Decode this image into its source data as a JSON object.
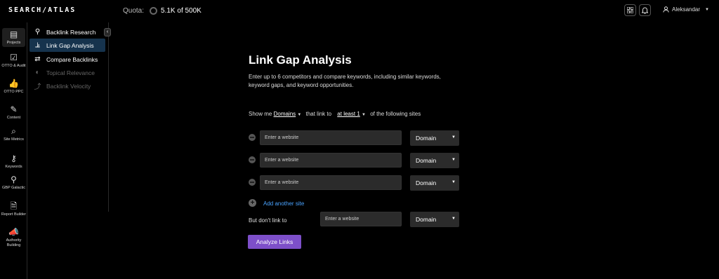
{
  "header": {
    "logo_text": "SEARCH/ATLAS",
    "quota_label": "Quota:",
    "quota_value": "5.1K of 500K",
    "user_name": "Aleksandar"
  },
  "rail": {
    "items": [
      {
        "label": "Projects",
        "icon": "projects-icon"
      },
      {
        "label": "OTTO & Audit",
        "icon": "otto-audit-icon"
      },
      {
        "label": "OTTO PPC",
        "icon": "thumbs-up-icon"
      },
      {
        "label": "Content",
        "icon": "pencil-icon"
      },
      {
        "label": "Site Metrics",
        "icon": "magnify-icon"
      },
      {
        "label": "Keywords",
        "icon": "key-icon"
      },
      {
        "label": "GBP Galactic",
        "icon": "map-pin-icon"
      },
      {
        "label": "Report Builder",
        "icon": "report-icon"
      },
      {
        "label": "Authority Building",
        "icon": "megaphone-icon"
      }
    ]
  },
  "submenu": {
    "items": [
      {
        "label": "Backlink Research",
        "icon": "search-icon"
      },
      {
        "label": "Link Gap Analysis",
        "icon": "chart-icon"
      },
      {
        "label": "Compare Backlinks",
        "icon": "swap-icon"
      },
      {
        "label": "Topical Relevance",
        "icon": "toggle-icon"
      },
      {
        "label": "Backlink Velocity",
        "icon": "trend-icon"
      }
    ]
  },
  "main": {
    "title": "Link Gap Analysis",
    "description": "Enter up to 6 competitors and compare keywords, including similar keywords, keyword gaps, and keyword opportunities.",
    "filter": {
      "show_me": "Show me",
      "entity": "Domains",
      "that_link_to": "that link to",
      "quantity": "at least 1",
      "suffix": "of the following sites"
    },
    "site_rows": [
      {
        "placeholder": "Enter a website",
        "type": "Domain"
      },
      {
        "placeholder": "Enter a website",
        "type": "Domain"
      },
      {
        "placeholder": "Enter a website",
        "type": "Domain"
      }
    ],
    "add_site": "Add another site",
    "exclude": {
      "label": "But don't link to",
      "placeholder": "Enter a website",
      "type": "Domain"
    },
    "analyze_button": "Analyze Links"
  },
  "colors": {
    "accent": "#7d4fc9",
    "active_nav": "#16334d",
    "link": "#4aa3ff"
  }
}
